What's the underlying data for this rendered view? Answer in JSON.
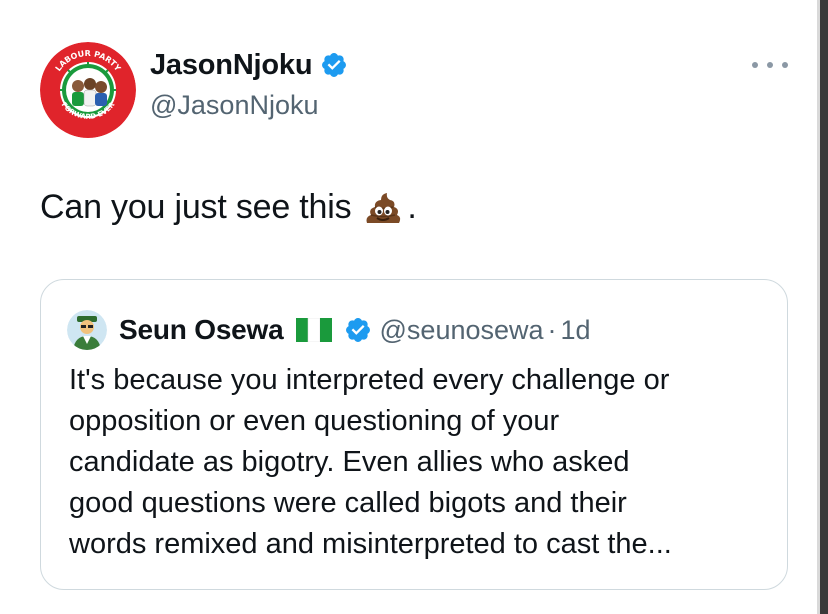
{
  "tweet": {
    "author": {
      "display_name": "JasonNjoku",
      "handle": "@JasonNjoku",
      "avatar_icon": "labour-party-logo-avatar",
      "avatar_ring_text_top": "LABOUR PARTY",
      "avatar_ring_text_bottom": "FORWARD EVER",
      "verified_icon": "verified-badge-icon"
    },
    "more_icon": "more-options-icon",
    "text": "Can you just see this",
    "emoji": "pile-of-poo-emoji",
    "text_suffix": ".",
    "quote": {
      "display_name": "Seun Osewa",
      "flag_icon": "nigeria-flag-icon",
      "handle": "@seunosewa",
      "separator": "·",
      "time": "1d",
      "body_lines": [
        "It's because you interpreted every challenge or",
        "opposition or even questioning of your",
        "candidate as bigotry. Even allies who asked",
        "good questions were called bigots and their",
        "words remixed and misinterpreted to cast the..."
      ]
    }
  },
  "colors": {
    "text": "#0f1419",
    "secondary_text": "#536471",
    "verified_blue": "#1d9bf0",
    "border": "#cfd9de",
    "labour_red": "#e0242b",
    "labour_green": "#1a9a3c"
  }
}
